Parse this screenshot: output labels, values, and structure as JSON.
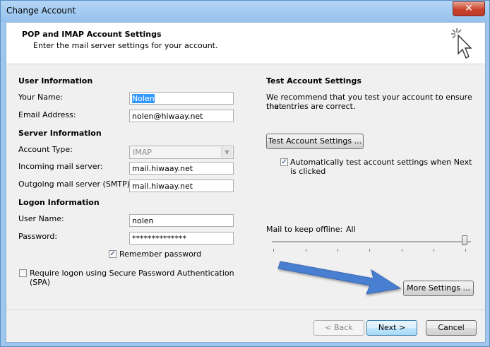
{
  "window": {
    "title": "Change Account",
    "close_label": "✕"
  },
  "header": {
    "title": "POP and IMAP Account Settings",
    "subtitle": "Enter the mail server settings for your account.",
    "icon": "cursor-sparkle-icon"
  },
  "user_info": {
    "section": "User Information",
    "name_label": "Your Name:",
    "name_value": "Nolen",
    "email_label": "Email Address:",
    "email_value": "nolen@hiwaay.net"
  },
  "server_info": {
    "section": "Server Information",
    "account_type_label": "Account Type:",
    "account_type_value": "IMAP",
    "incoming_label": "Incoming mail server:",
    "incoming_value": "mail.hiwaay.net",
    "outgoing_label": "Outgoing mail server (SMTP):",
    "outgoing_value": "mail.hiwaay.net"
  },
  "logon_info": {
    "section": "Logon Information",
    "username_label": "User Name:",
    "username_value": "nolen",
    "password_label": "Password:",
    "password_value": "**************",
    "remember_label": "Remember password",
    "remember_checked": true,
    "spa_label_line1": "Require logon using Secure Password Authentication",
    "spa_label_line2": "(SPA)",
    "spa_checked": false
  },
  "test_settings": {
    "section": "Test Account Settings",
    "desc_line1": "We recommend that you test your account to ensure that",
    "desc_line2": "the entries are correct.",
    "test_button": "Test Account Settings ...",
    "auto_test_line1": "Automatically test account settings when Next",
    "auto_test_line2": "is clicked",
    "auto_test_checked": true
  },
  "offline": {
    "label": "Mail to keep offline:",
    "value": "All",
    "slider_level_fraction": 1.0
  },
  "more_settings_button": "More Settings ...",
  "annotation": {
    "arrow_color": "#4a7fd0"
  },
  "footer": {
    "back_button": "< Back",
    "next_button": "Next >",
    "cancel_button": "Cancel"
  }
}
